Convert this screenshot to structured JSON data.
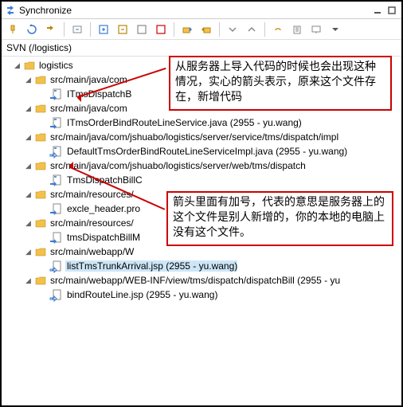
{
  "title": "Synchronize",
  "svn_header": "SVN (/logistics)",
  "callouts": {
    "c1": "从服务器上导入代码的时候也会出现这种情况，实心的箭头表示，原来这个文件存在，新增代码",
    "c2": "箭头里面有加号，代表的意思是服务器上的这个文件是别人新增的，你的本地的电脑上没有这个文件。"
  },
  "tree": {
    "root": "logistics",
    "n1": "src/main/java/com",
    "n1f": "ITmsDispatchB",
    "n2": "src/main/java/com",
    "n2f": "ITmsOrderBindRouteLineService.java (2955 - yu.wang)",
    "n3": "src/main/java/com/jshuabo/logistics/server/service/tms/dispatch/impl",
    "n3f": "DefaultTmsOrderBindRouteLineServiceImpl.java (2955 - yu.wang)",
    "n4": "src/main/java/com/jshuabo/logistics/server/web/tms/dispatch",
    "n4f": "TmsDispatchBillC",
    "n5": "src/main/resources/",
    "n5f": "excle_header.pro",
    "n6": "src/main/resources/",
    "n6f": "tmsDispatchBillM",
    "n7": "src/main/webapp/W",
    "n7f": "listTmsTrunkArrival.jsp (2955 - yu.wang)",
    "n8": "src/main/webapp/WEB-INF/view/tms/dispatch/dispatchBill (2955 - yu",
    "n8f": "bindRouteLine.jsp (2955 - yu.wang)"
  }
}
